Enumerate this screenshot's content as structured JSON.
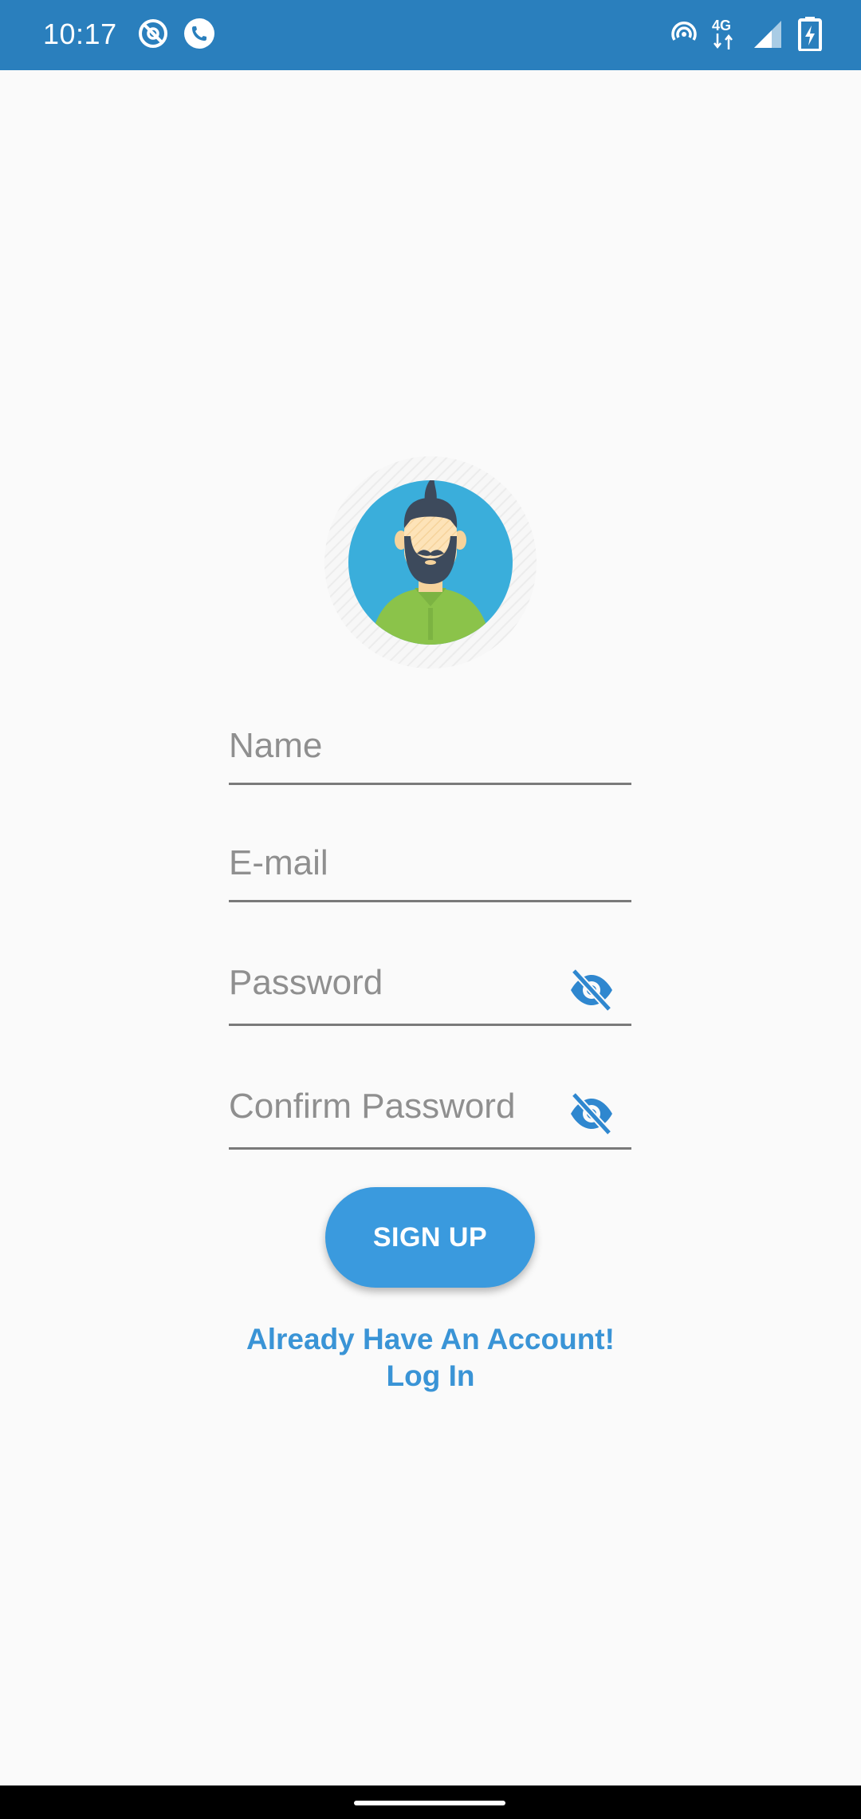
{
  "status_bar": {
    "time": "10:17",
    "network_label": "4G",
    "color": "#2a7fbd",
    "icons": [
      "do-not-disturb-icon",
      "call-icon",
      "hotspot-icon",
      "network-4g-icon",
      "signal-icon",
      "battery-charging-icon"
    ]
  },
  "avatar": {
    "icon": "user-avatar-illustration",
    "background_color": "#3aaedb",
    "shirt_color": "#8bc34a"
  },
  "form": {
    "name": {
      "placeholder": "Name",
      "value": ""
    },
    "email": {
      "placeholder": "E-mail",
      "value": ""
    },
    "password": {
      "placeholder": "Password",
      "value": "",
      "toggle_icon": "eye-off-icon"
    },
    "confirm_password": {
      "placeholder": "Confirm Password",
      "value": "",
      "toggle_icon": "eye-off-icon"
    }
  },
  "signup_button": {
    "label": "SIGN UP",
    "color": "#3a9ade"
  },
  "login_link": {
    "line1": "Already Have An Account!",
    "line2": "Log In",
    "color": "#3a94d6"
  }
}
